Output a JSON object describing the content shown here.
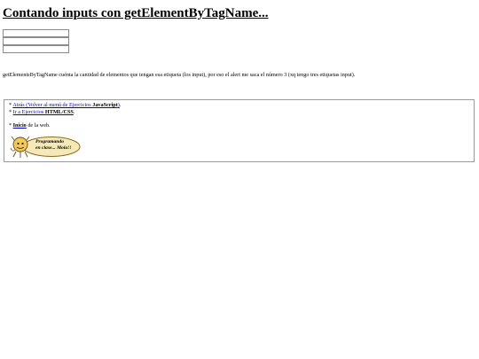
{
  "header": {
    "title": "Contando inputs con getElementByTagName..."
  },
  "form": {
    "inputs": [
      {
        "value": "",
        "placeholder": ""
      },
      {
        "value": "",
        "placeholder": ""
      },
      {
        "value": "",
        "placeholder": ""
      }
    ]
  },
  "explanation": "getElementsByTagName cuénta la cantidad de elementos que tengan esa etiqueta (los input), por eso el alert me saca el número 3 (xq tengo tres etiquetas input).",
  "footer": {
    "back_prefix": "* ",
    "back_link_text": "Atrás (Volver al menú de Ejercicios ",
    "back_link_bold": "JavaScript",
    "back_link_suffix": ")",
    "back_after": ".",
    "html_prefix": "* ",
    "html_link_text": "Ir a Ejercicios ",
    "html_link_bold": "HTML/CSS",
    "html_after": ".",
    "home_prefix": "* ",
    "home_link_bold": "Inicio",
    "home_after": " de la web.",
    "logo_line1": "Programando",
    "logo_line2": "en clase... Mola!!"
  }
}
